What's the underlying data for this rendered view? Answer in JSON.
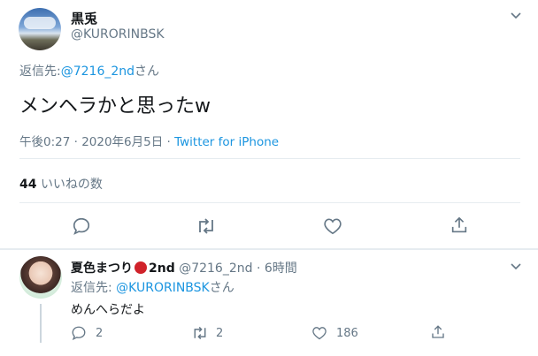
{
  "main_tweet": {
    "display_name": "黒兎",
    "handle": "@KURORINBSK",
    "reply_to_label": "返信先:",
    "reply_to_handle": "@7216_2nd",
    "reply_to_suffix": "さん",
    "text": "メンヘラかと思ったw",
    "time_date": "午後0:27 · 2020年6月5日 · ",
    "source": "Twitter for iPhone",
    "likes_count": "44",
    "likes_label": "いいねの数"
  },
  "reply_tweet": {
    "display_name": "夏色まつり",
    "name_suffix": "2nd",
    "handle": "@7216_2nd",
    "time": "· 6時間",
    "reply_to_label": "返信先:",
    "reply_to_handle": "@KURORINBSK",
    "reply_to_suffix": "さん",
    "text": "めんへらだよ",
    "reply_count": "2",
    "retweet_count": "2",
    "like_count": "186"
  },
  "colors": {
    "link": "#1b95e0",
    "secondary_text": "#657786",
    "badge_red": "#d0222a"
  }
}
